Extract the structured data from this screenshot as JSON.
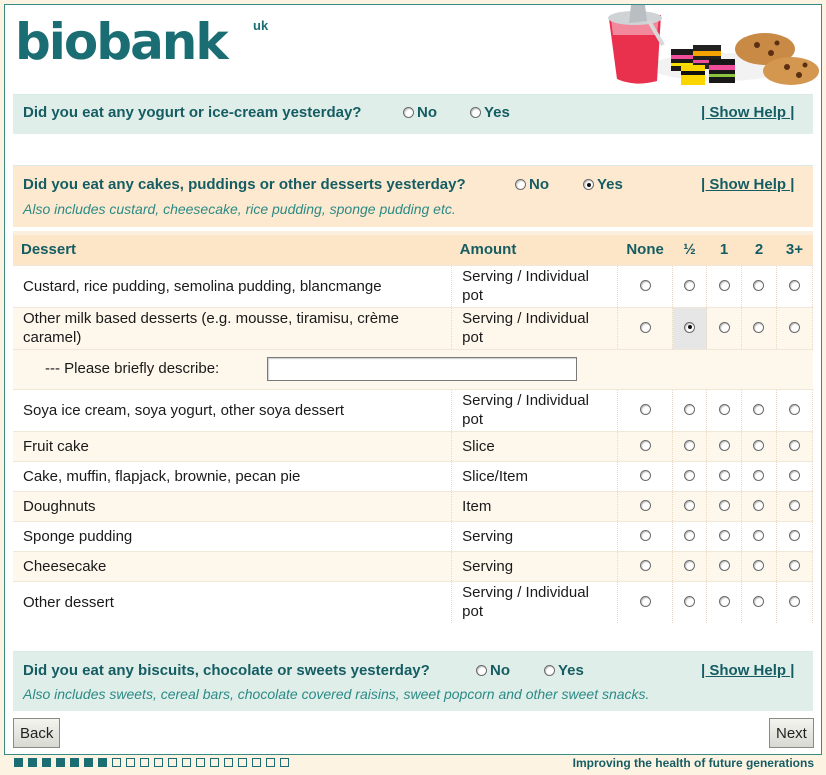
{
  "brand": {
    "name": "biobank",
    "suffix": "uk"
  },
  "q1": {
    "question": "Did you eat any yogurt or ice-cream yesterday?",
    "no_label": "No",
    "yes_label": "Yes",
    "selected": "none",
    "help_label": "| Show Help |"
  },
  "q2": {
    "question": "Did you eat any cakes, puddings or other desserts yesterday?",
    "no_label": "No",
    "yes_label": "Yes",
    "selected": "Yes",
    "help_label": "| Show Help |",
    "subtitle": "Also includes custard, cheesecake, rice pudding, sponge pudding etc."
  },
  "table": {
    "headers": {
      "dessert": "Dessert",
      "amount": "Amount",
      "none": "None",
      "half": "½",
      "one": "1",
      "two": "2",
      "three": "3+"
    },
    "rows": [
      {
        "dessert": "Custard, rice pudding, semolina pudding, blancmange",
        "amount": "Serving / Individual pot",
        "selected": ""
      },
      {
        "dessert": "Other milk based desserts (e.g. mousse, tiramisu, crème caramel)",
        "amount": "Serving / Individual pot",
        "selected": "½"
      },
      {
        "dessert": "Soya ice cream, soya yogurt, other soya dessert",
        "amount": "Serving / Individual pot",
        "selected": ""
      },
      {
        "dessert": "Fruit cake",
        "amount": "Slice",
        "selected": ""
      },
      {
        "dessert": "Cake, muffin, flapjack, brownie, pecan pie",
        "amount": "Slice/Item",
        "selected": ""
      },
      {
        "dessert": "Doughnuts",
        "amount": "Item",
        "selected": ""
      },
      {
        "dessert": "Sponge pudding",
        "amount": "Serving",
        "selected": ""
      },
      {
        "dessert": "Cheesecake",
        "amount": "Serving",
        "selected": ""
      },
      {
        "dessert": "Other dessert",
        "amount": "Serving / Individual pot",
        "selected": ""
      }
    ],
    "describe_label": "--- Please briefly describe:",
    "describe_value": ""
  },
  "q3": {
    "question": "Did you eat any biscuits, chocolate or sweets yesterday?",
    "no_label": "No",
    "yes_label": "Yes",
    "selected": "none",
    "help_label": "| Show Help |",
    "subtitle": "Also includes sweets, cereal bars, chocolate covered raisins, sweet popcorn and other sweet snacks."
  },
  "nav": {
    "back_label": "Back",
    "next_label": "Next"
  },
  "footer": {
    "tagline": "Improving the health of future generations",
    "progress_filled": 7,
    "progress_total": 20
  },
  "colors": {
    "brand": "#1a6e73",
    "green_band": "#e0eee9",
    "tan_band": "#fde9cf"
  }
}
